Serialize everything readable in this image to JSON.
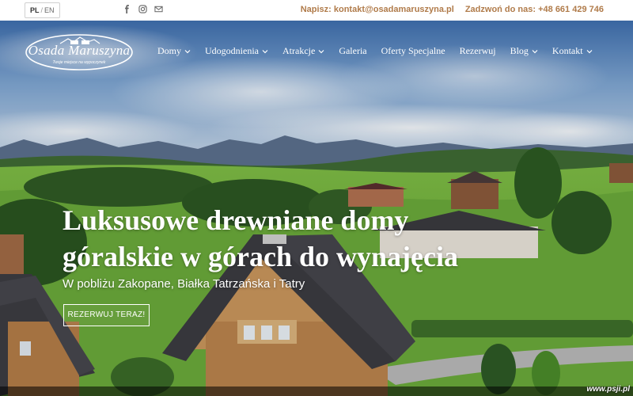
{
  "topbar": {
    "lang_active": "PL",
    "lang_separator": "/",
    "lang_other": "EN",
    "email": "Napisz: kontakt@osadamaruszyna.pl",
    "phone": "Zadzwoń do nas: +48 661 429 746",
    "social_icons": [
      "facebook-icon",
      "instagram-icon",
      "mail-icon"
    ]
  },
  "logo": {
    "name": "Osada Maruszyna",
    "tagline": "Twoje miejsce na wypoczynek"
  },
  "nav": {
    "items": [
      {
        "label": "Domy",
        "dropdown": true
      },
      {
        "label": "Udogodnienia",
        "dropdown": true
      },
      {
        "label": "Atrakcje",
        "dropdown": true
      },
      {
        "label": "Galeria",
        "dropdown": false
      },
      {
        "label": "Oferty Specjalne",
        "dropdown": false
      },
      {
        "label": "Rezerwuj",
        "dropdown": false
      },
      {
        "label": "Blog",
        "dropdown": true
      },
      {
        "label": "Kontakt",
        "dropdown": true
      }
    ]
  },
  "hero": {
    "headline_line1": "Luksusowe drewniane domy",
    "headline_line2": "góralskie w górach do wynajęcia",
    "subline": "W pobliżu Zakopane, Białka Tatrzańska i Tatry",
    "cta": "REZERWUJ TERAZ!"
  },
  "watermark": "www.psji.pl",
  "colors": {
    "accent": "#b07b4a",
    "sky": "#4f7fb8",
    "grass": "#6fae3a"
  }
}
